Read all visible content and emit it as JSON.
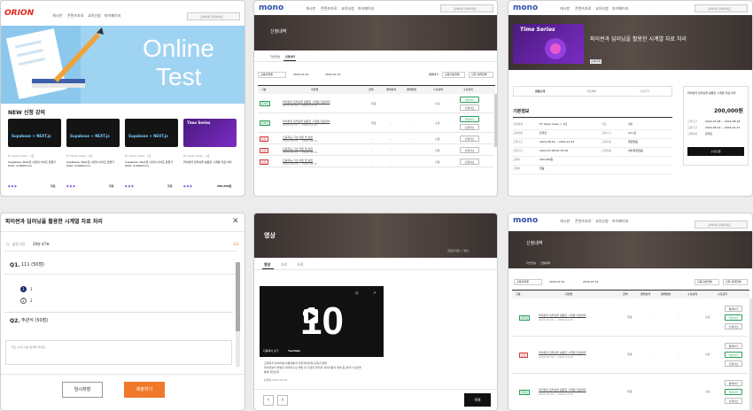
{
  "p1": {
    "logo": "ORION",
    "nav": [
      "게시판",
      "콘텐츠자료",
      "교육신청",
      "마이페이지"
    ],
    "search_placeholder": "검색어를 입력하세요",
    "hero_line1": "Online",
    "hero_line2": "Test",
    "section_title": "NEW 신청 강의",
    "card_courses": [
      {
        "thumb": "Supabase + NEXT.js",
        "meta": "HY Open Class · 1년",
        "title": "Supabase, Next로 나만의 사이트 만들기 (feat. ai-Webtoon)",
        "price": "무료"
      },
      {
        "thumb": "Supabase + NEXT.js",
        "meta": "HY Open Class · 1년",
        "title": "Supabase, Next로 나만의 사이트 만들기 (feat. ai-Webtoon)",
        "price": "무료"
      },
      {
        "thumb": "Supabase + NEXT.js",
        "meta": "HY Open Class · 1년",
        "title": "Supabase, Next로 나만의 사이트 만들기 (feat. ai-Webtoon)",
        "price": "무료"
      },
      {
        "thumb": "Time Series",
        "meta": "HY Open Class · 1년",
        "title": "파이썬과 딥러닝을 활용한 시계열 자료 처리",
        "price": "200,000원"
      }
    ]
  },
  "p2": {
    "logo": "mono",
    "nav": [
      "게시판",
      "콘텐츠자료",
      "교육신청",
      "마이페이지"
    ],
    "search_placeholder": "검색어를 입력하세요",
    "page_title": "신청내역",
    "tabs": [
      "학습현황",
      "신청내역"
    ],
    "filter_select": "교육과정명",
    "date_from": "2024-07-01",
    "date_to": "2024-07-31",
    "checkbox_label": "결제대기",
    "select2": "교육구분전체",
    "select3": "신청 상태전체",
    "headers": [
      "구분",
      "과정명",
      "금액",
      "결제상태",
      "결제방법",
      "수강상태",
      "수강관리"
    ],
    "rows": [
      {
        "badge": "온라인",
        "type": "g",
        "title": "파이썬과 딥러닝을 활용한 시계열 자료처리",
        "date": "2024-07-01 ~ 2024-12-31",
        "amount": "무료",
        "pay": "-",
        "method": "-",
        "status": "수강",
        "btn1": "학습하기",
        "btn2": "신청취소"
      },
      {
        "badge": "온라인",
        "type": "g",
        "title": "파이썬과 딥러닝을 활용한 시계열 자료처리",
        "date": "2024-07-01 ~ 2024-12-31",
        "amount": "무료",
        "pay": "-",
        "method": "-",
        "status": "수강",
        "btn1": "학습하기",
        "btn2": "신청취소"
      },
      {
        "badge": "오프",
        "type": "r",
        "title": "인공지능 기초 이론 및 실습",
        "date": "2024-08-01 ~ 2024-08-31",
        "amount": "-",
        "pay": "-",
        "method": "-",
        "status": "신청",
        "btn1": "신청취소",
        "btn2": ""
      },
      {
        "badge": "오프",
        "type": "r",
        "title": "인공지능 기초 이론 및 실습",
        "date": "2024-08-01 ~ 2024-08-31",
        "amount": "-",
        "pay": "-",
        "method": "-",
        "status": "신청",
        "btn1": "신청취소",
        "btn2": ""
      },
      {
        "badge": "오프",
        "type": "r",
        "title": "인공지능 기초 이론 및 실습",
        "date": "2024-08-01 ~ 2024-08-31",
        "amount": "-",
        "pay": "-",
        "method": "-",
        "status": "신청",
        "btn1": "신청취소",
        "btn2": ""
      }
    ]
  },
  "p3": {
    "logo": "mono",
    "nav": [
      "게시판",
      "콘텐츠자료",
      "교육신청",
      "마이페이지"
    ],
    "search_placeholder": "검색어를 입력하세요",
    "thumb_text": "Time Series",
    "course_title": "파이썬과 딥러닝을 활용한 시계열 자료 처리",
    "category_badge": "교육과정",
    "tabs": [
      "과정소개",
      "과정목록",
      "수강후기"
    ],
    "section_title": "기본정보",
    "info": [
      {
        "k": "과정분류",
        "v": "HY Open Class > 1년"
      },
      {
        "k": "교육방법",
        "v": "온라인"
      },
      {
        "k": "교육기간",
        "v": "2024-08-19 ~ 2024-12-31"
      },
      {
        "k": "신청기간",
        "v": "2024-07-08 09:15:38"
      },
      {
        "k": "교육비",
        "v": "200,000원"
      },
      {
        "k": "교재비",
        "v": "없음"
      }
    ],
    "info_right": [
      {
        "k": "학점",
        "v": "3점"
      },
      {
        "k": "교육시간",
        "v": "12시간"
      },
      {
        "k": "교육인원",
        "v": "제한없음"
      },
      {
        "k": "신청현황",
        "v": "0명/제한없음"
      }
    ],
    "side_title": "파이썬과 딥러닝을 활용한 시계열 자료 처리",
    "side_price": "200,000원",
    "side_rows": [
      {
        "k": "신청기간",
        "v": "2024-07-08 ~ 2024-08-18"
      },
      {
        "k": "교육기간",
        "v": "2024-08-19 ~ 2024-12-31"
      },
      {
        "k": "교육방법",
        "v": "온라인"
      }
    ],
    "side_button": "수강신청"
  },
  "p4": {
    "title": "파이썬과 딥러닝을 활용한 시계열 자료 처리",
    "timer_label": "남은시간",
    "timer_value": "29분 47초",
    "progress": "1/2",
    "q1_label": "Q1.",
    "q1_text": "111 (50점)",
    "choices": [
      "1",
      "2"
    ],
    "q2_label": "Q2.",
    "q2_text": "주관식 (50점)",
    "textarea_placeholder": "최소 10자 이상 입력해 주세요.",
    "save_button": "임시저장",
    "submit_button": "제출하기"
  },
  "p5": {
    "page_title": "영상",
    "breadcrumb": "콘텐츠자료 > 영상",
    "tabs": [
      "영상",
      "자료",
      "사례"
    ],
    "video_number": "10",
    "video_caption": "다음에서 보기",
    "youtube": "YouTube",
    "desc_lines": [
      "교육목적 데이터분석/통계분석 전문역량강화/교육/다양화",
      "데이터분석 방법과 데이터수집 방법 및 다양한 목적의 데이터분석 방법 등 분석기 실습을",
      "통해 학습한다"
    ],
    "desc_date": "등록일 2024.05.22",
    "list_button": "목록"
  },
  "p6": {
    "logo": "mono",
    "nav": [
      "게시판",
      "콘텐츠자료",
      "교육신청",
      "마이페이지"
    ],
    "search_placeholder": "검색어를 입력하세요",
    "page_title": "신청내역",
    "tabs": [
      "학습현황",
      "신청내역"
    ],
    "filter_select": "교육과정명",
    "date_from": "2024-07-01",
    "date_to": "2024-07-31",
    "select2": "교육구분전체",
    "select3": "신청 상태전체",
    "headers": [
      "구분",
      "과정명",
      "금액",
      "결제상태",
      "결제방법",
      "수강상태",
      "수강관리"
    ],
    "rows": [
      {
        "badge": "온라인",
        "type": "g",
        "title": "파이썬과 딥러닝을 활용한 시계열 자료처리",
        "date": "2024-07-01 ~ 2024-12-31",
        "amount": "무료",
        "pay": "-",
        "method": "-",
        "status": "수강",
        "btn1": "결제하기",
        "btn2": "학습하기",
        "btn3": "신청취소"
      },
      {
        "badge": "오프",
        "type": "r",
        "title": "파이썬과 딥러닝을 활용한 시계열 자료처리",
        "date": "2024-07-01 ~ 2024-12-31",
        "amount": "무료",
        "pay": "-",
        "method": "-",
        "status": "수강",
        "btn1": "결제하기",
        "btn2": "학습하기",
        "btn3": "신청취소"
      },
      {
        "badge": "온라인",
        "type": "g",
        "title": "파이썬과 딥러닝을 활용한 시계열 자료처리",
        "date": "2024-07-01 ~ 2024-12-31",
        "amount": "무료",
        "pay": "-",
        "method": "-",
        "status": "수강",
        "btn1": "결제하기",
        "btn2": "학습하기",
        "btn3": "신청취소"
      }
    ]
  },
  "colors": {
    "orion_red": "#e2231a",
    "mono_blue": "#2f4fa8",
    "submit_orange": "#f0782a",
    "hero_blue": "#9fd3f2"
  }
}
